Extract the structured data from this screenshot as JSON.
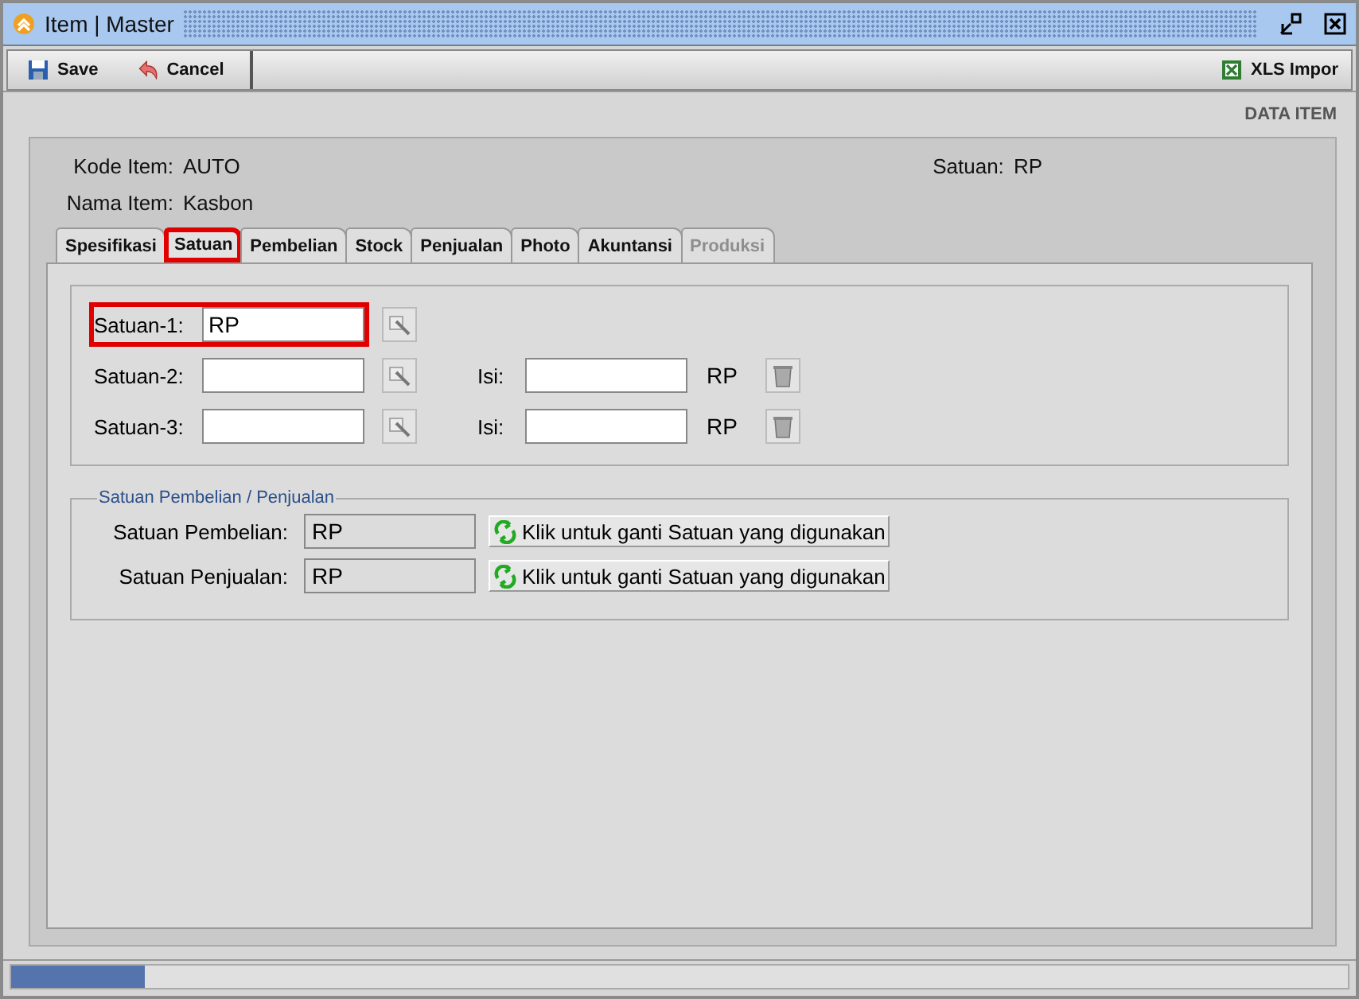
{
  "window": {
    "title": "Item | Master"
  },
  "toolbar": {
    "buttons": [
      {
        "label": "Save",
        "kind": "save"
      },
      {
        "label": "Cancel",
        "kind": "cancel"
      }
    ],
    "right_button": {
      "label": "XLS Impor",
      "kind": "excel"
    }
  },
  "section_title": "DATA ITEM",
  "header": {
    "fields": [
      {
        "label": "Kode Item:",
        "value": "AUTO"
      },
      {
        "label": "Nama Item:",
        "value": "Kasbon"
      }
    ],
    "unit": {
      "label": "Satuan:",
      "value": "RP"
    }
  },
  "tabs": [
    {
      "label": "Spesifikasi",
      "selected": false,
      "disabled": false
    },
    {
      "label": "Satuan",
      "selected": true,
      "disabled": false
    },
    {
      "label": "Pembelian",
      "selected": false,
      "disabled": false
    },
    {
      "label": "Stock",
      "selected": false,
      "disabled": false
    },
    {
      "label": "Penjualan",
      "selected": false,
      "disabled": false
    },
    {
      "label": "Photo",
      "selected": false,
      "disabled": false
    },
    {
      "label": "Akuntansi",
      "selected": false,
      "disabled": false
    },
    {
      "label": "Produksi",
      "selected": false,
      "disabled": true
    }
  ],
  "units": [
    {
      "label": "Satuan-1:",
      "value": "RP",
      "highlighted": true
    },
    {
      "label": "Satuan-2:",
      "highlighted": false,
      "isi_label": "Isi:",
      "base_unit": "RP"
    },
    {
      "label": "Satuan-3:",
      "highlighted": false,
      "isi_label": "Isi:",
      "base_unit": "RP"
    }
  ],
  "purchase_sales": {
    "legend": "Satuan Pembelian / Penjualan",
    "rows": [
      {
        "label": "Satuan Pembelian:",
        "value": "RP",
        "button": "Klik untuk ganti Satuan yang digunakan"
      },
      {
        "label": "Satuan Penjualan:",
        "value": "RP",
        "button": "Klik untuk ganti Satuan yang digunakan"
      }
    ]
  },
  "status_bar": {
    "progress": {
      "level": 0.1
    }
  }
}
